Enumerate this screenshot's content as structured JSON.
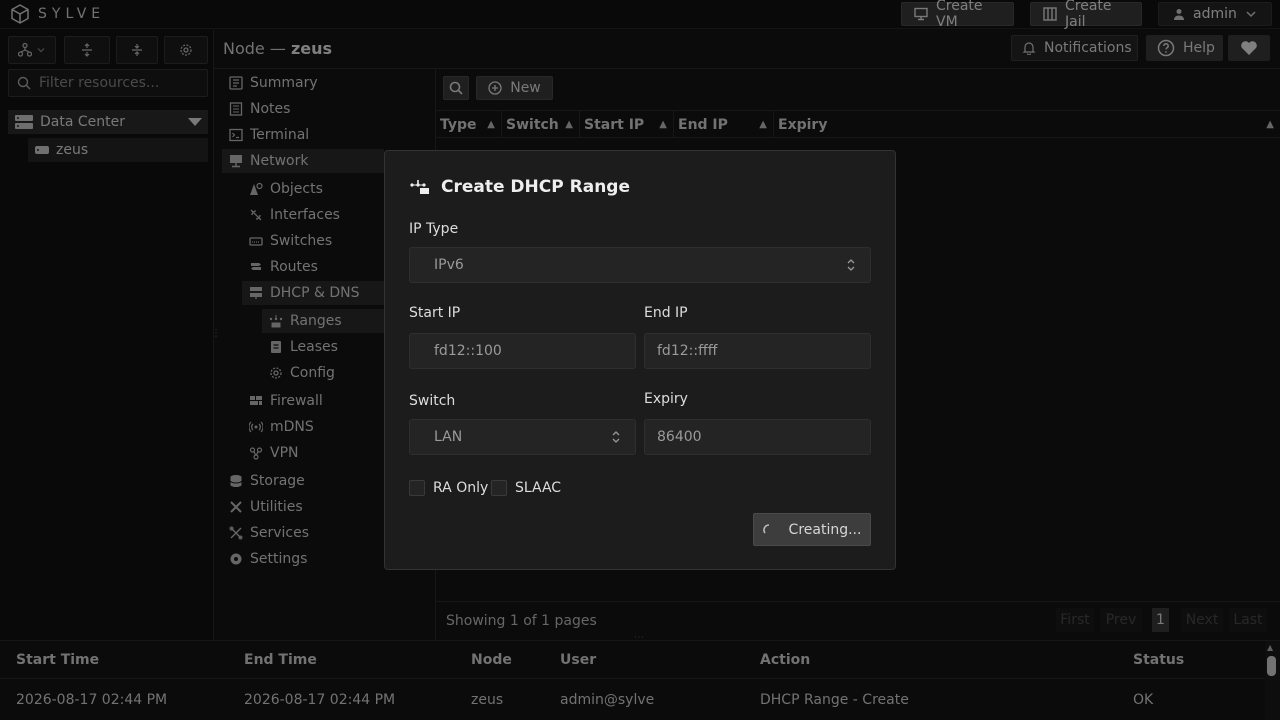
{
  "app": {
    "brand": "SYLVE"
  },
  "topbar": {
    "create_vm": "Create VM",
    "create_jail": "Create Jail",
    "user": "admin"
  },
  "left": {
    "filter_placeholder": "Filter resources...",
    "tree": [
      {
        "label": "Data Center"
      },
      {
        "label": "zeus"
      }
    ]
  },
  "node_header": {
    "prefix": "Node —",
    "name": "zeus",
    "notifications": "Notifications",
    "help": "Help"
  },
  "nav": {
    "items": [
      {
        "label": "Summary",
        "icon": "summary-icon"
      },
      {
        "label": "Notes",
        "icon": "notes-icon"
      },
      {
        "label": "Terminal",
        "icon": "terminal-icon"
      },
      {
        "label": "Network",
        "icon": "network-icon"
      },
      {
        "label": "Objects",
        "icon": "objects-icon"
      },
      {
        "label": "Interfaces",
        "icon": "interfaces-icon"
      },
      {
        "label": "Switches",
        "icon": "switches-icon"
      },
      {
        "label": "Routes",
        "icon": "routes-icon"
      },
      {
        "label": "DHCP & DNS",
        "icon": "dhcp-icon"
      },
      {
        "label": "Ranges",
        "icon": "ranges-icon"
      },
      {
        "label": "Leases",
        "icon": "leases-icon"
      },
      {
        "label": "Config",
        "icon": "config-icon"
      },
      {
        "label": "Firewall",
        "icon": "firewall-icon"
      },
      {
        "label": "mDNS",
        "icon": "mdns-icon"
      },
      {
        "label": "VPN",
        "icon": "vpn-icon"
      },
      {
        "label": "Storage",
        "icon": "storage-icon"
      },
      {
        "label": "Utilities",
        "icon": "utilities-icon"
      },
      {
        "label": "Services",
        "icon": "services-icon"
      },
      {
        "label": "Settings",
        "icon": "settings-icon"
      }
    ]
  },
  "main": {
    "new_label": "New",
    "columns": [
      "Type",
      "Switch",
      "Start IP",
      "End IP",
      "Expiry"
    ],
    "pager": {
      "text": "Showing 1 of 1 pages",
      "first": "First",
      "prev": "Prev",
      "page": "1",
      "next": "Next",
      "last": "Last"
    }
  },
  "log": {
    "columns": [
      "Start Time",
      "End Time",
      "Node",
      "User",
      "Action",
      "Status"
    ],
    "row": [
      "2026-08-17 02:44 PM",
      "2026-08-17 02:44 PM",
      "zeus",
      "admin@sylve",
      "DHCP Range - Create",
      "OK"
    ]
  },
  "modal": {
    "title": "Create DHCP Range",
    "ip_type_label": "IP Type",
    "ip_type_value": "IPv6",
    "start_ip_label": "Start IP",
    "start_ip_value": "fd12::100",
    "end_ip_label": "End IP",
    "end_ip_value": "fd12::ffff",
    "switch_label": "Switch",
    "switch_value": "LAN",
    "expiry_label": "Expiry",
    "expiry_value": "86400",
    "ra_only_label": "RA Only",
    "slaac_label": "SLAAC",
    "submit_label": "Creating..."
  }
}
